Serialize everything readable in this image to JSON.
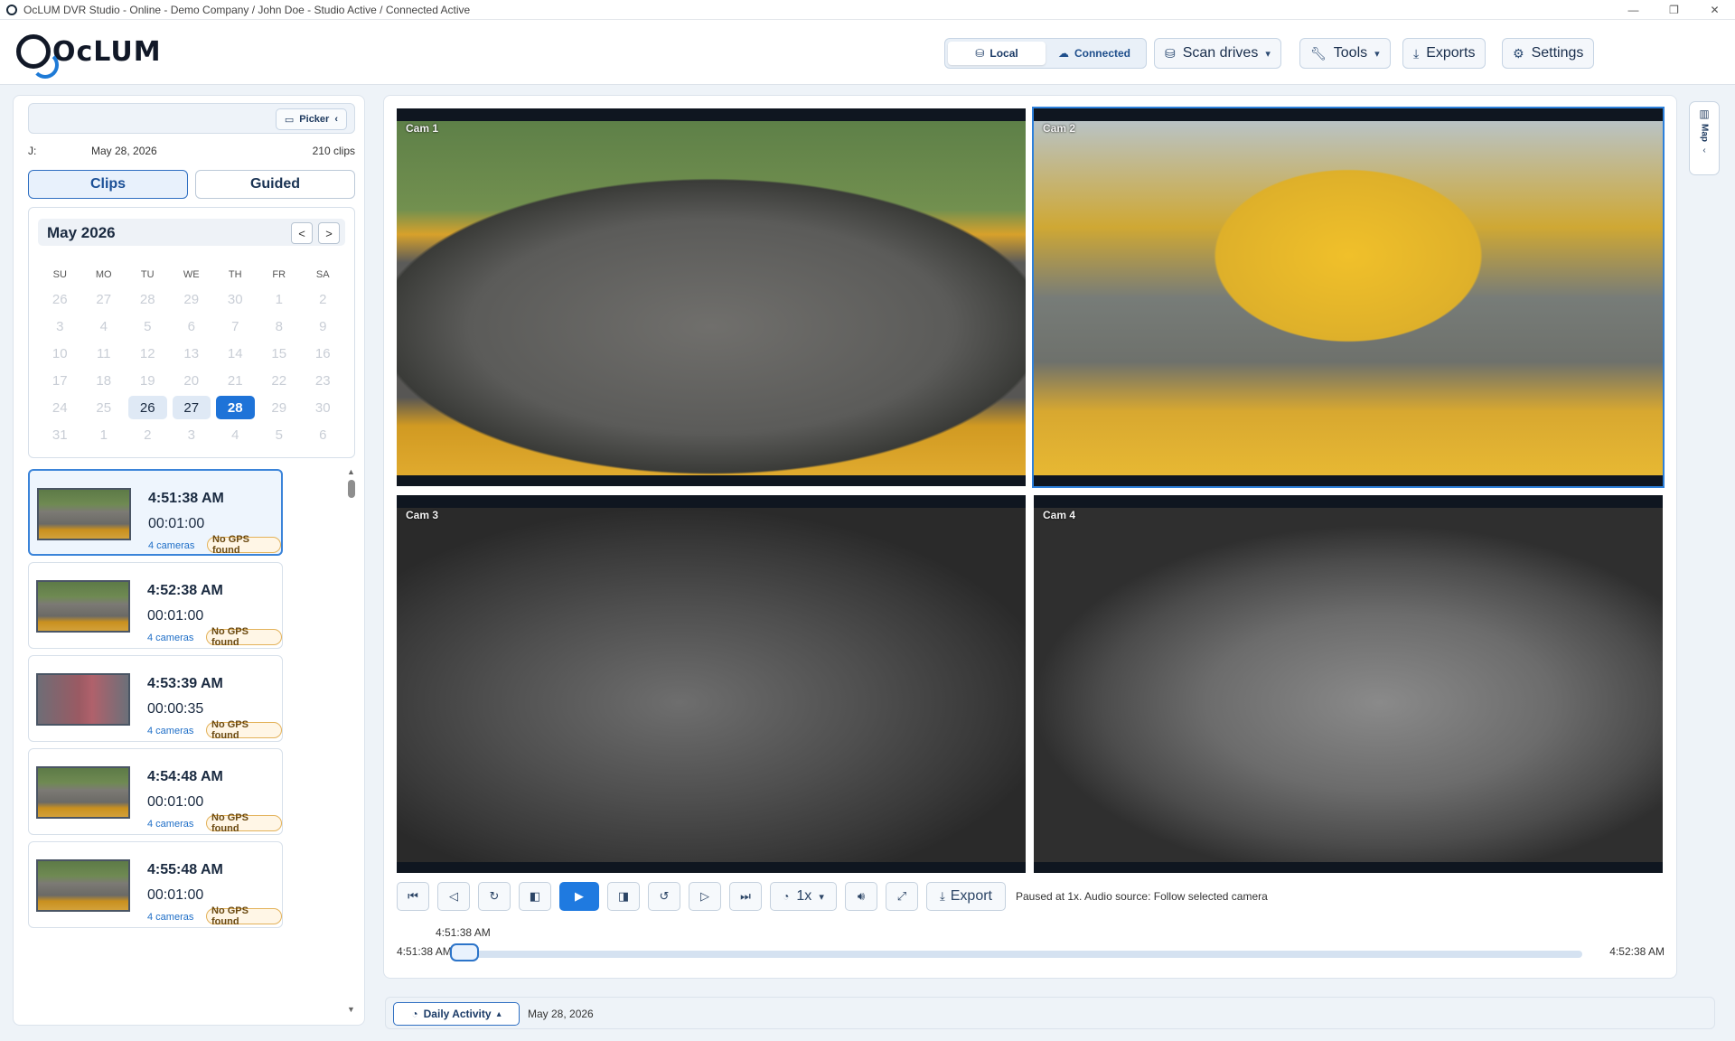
{
  "window": {
    "title": "OcLUM DVR Studio - Online - Demo Company / John Doe - Studio Active / Connected Active",
    "controls": [
      "—",
      "❐",
      "✕"
    ]
  },
  "header": {
    "logo_text": "OcLUM",
    "mode": {
      "local": "Local",
      "connected": "Connected",
      "active": "local"
    },
    "scan_drives": "Scan drives",
    "tools": "Tools",
    "exports": "Exports",
    "settings": "Settings"
  },
  "picker": {
    "button": "Picker",
    "j_label": "J:",
    "date": "May 28, 2026",
    "clip_count": "210 clips"
  },
  "tabs": {
    "clips": "Clips",
    "guided": "Guided",
    "active": "clips"
  },
  "calendar": {
    "title": "May 2026",
    "prev": "<",
    "next": ">",
    "dow": [
      "SU",
      "MO",
      "TU",
      "WE",
      "TH",
      "FR",
      "SA"
    ],
    "weeks": [
      [
        "26",
        "27",
        "28",
        "29",
        "30",
        "1",
        "2"
      ],
      [
        "3",
        "4",
        "5",
        "6",
        "7",
        "8",
        "9"
      ],
      [
        "10",
        "11",
        "12",
        "13",
        "14",
        "15",
        "16"
      ],
      [
        "17",
        "18",
        "19",
        "20",
        "21",
        "22",
        "23"
      ],
      [
        "24",
        "25",
        "26",
        "27",
        "28",
        "29",
        "30"
      ],
      [
        "31",
        "1",
        "2",
        "3",
        "4",
        "5",
        "6"
      ]
    ],
    "has_clips": [
      "26",
      "27"
    ],
    "selected": "28"
  },
  "clips": [
    {
      "time": "4:51:38 AM",
      "duration": "00:01:00",
      "cameras": "4 cameras",
      "gps": "No GPS found",
      "selected": true
    },
    {
      "time": "4:52:38 AM",
      "duration": "00:01:00",
      "cameras": "4 cameras",
      "gps": "No GPS found"
    },
    {
      "time": "4:53:39 AM",
      "duration": "00:00:35",
      "cameras": "4 cameras",
      "gps": "No GPS found"
    },
    {
      "time": "4:54:48 AM",
      "duration": "00:01:00",
      "cameras": "4 cameras",
      "gps": "No GPS found"
    },
    {
      "time": "4:55:48 AM",
      "duration": "00:01:00",
      "cameras": "4 cameras",
      "gps": "No GPS found"
    }
  ],
  "cameras": [
    {
      "label": "Cam 1"
    },
    {
      "label": "Cam 2",
      "selected": true
    },
    {
      "label": "Cam 3"
    },
    {
      "label": "Cam 4"
    }
  ],
  "player": {
    "speed": "1x",
    "export": "Export",
    "status": "Paused at 1x. Audio source: Follow selected camera",
    "current": "4:51:38 AM",
    "start": "4:51:38 AM",
    "end": "4:52:38 AM",
    "progress": 0.0
  },
  "side": {
    "map": "Map"
  },
  "bottom": {
    "daily": "Daily Activity",
    "date": "May 28, 2026"
  },
  "colors": {
    "accent": "#1f7ae0",
    "gps_badge_border": "#e3b25a"
  }
}
